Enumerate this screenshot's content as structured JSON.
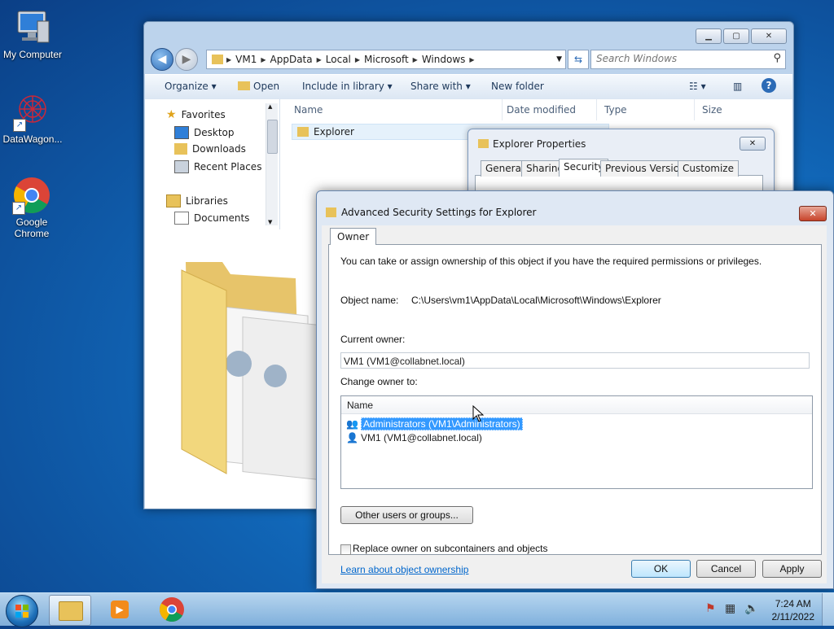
{
  "desktop": {
    "icons": [
      {
        "label": "My Computer"
      },
      {
        "label": "DataWagon..."
      },
      {
        "label": "Google Chrome"
      }
    ]
  },
  "explorer": {
    "breadcrumbs": [
      "VM1",
      "AppData",
      "Local",
      "Microsoft",
      "Windows"
    ],
    "search_placeholder": "Search Windows",
    "toolbar": {
      "organize": "Organize",
      "open": "Open",
      "include": "Include in library",
      "share": "Share with",
      "new_folder": "New folder"
    },
    "nav": {
      "favorites": "Favorites",
      "desktop": "Desktop",
      "downloads": "Downloads",
      "recent": "Recent Places",
      "libraries": "Libraries",
      "documents": "Documents"
    },
    "columns": [
      "Name",
      "Date modified",
      "Type",
      "Size"
    ],
    "file_item": "Explorer"
  },
  "properties": {
    "title": "Explorer Properties",
    "tabs": [
      "General",
      "Sharing",
      "Security",
      "Previous Versions",
      "Customize"
    ],
    "active_tab": "Security"
  },
  "advanced": {
    "title": "Advanced Security Settings for Explorer",
    "tab": "Owner",
    "intro": "You can take or assign ownership of this object if you have the required permissions or privileges.",
    "object_name_label": "Object name:",
    "object_name_value": "C:\\Users\\vm1\\AppData\\Local\\Microsoft\\Windows\\Explorer",
    "current_owner_label": "Current owner:",
    "current_owner_value": "VM1 (VM1@collabnet.local)",
    "change_owner_label": "Change owner to:",
    "list_header": "Name",
    "owners": [
      {
        "name": "Administrators (VM1\\Administrators)",
        "selected": true
      },
      {
        "name": "VM1 (VM1@collabnet.local)",
        "selected": false
      }
    ],
    "other_users_button": "Other users or groups...",
    "replace_checkbox_label": "Replace owner on subcontainers and objects",
    "replace_checked": false,
    "learn_link": "Learn about object ownership",
    "ok": "OK",
    "cancel": "Cancel",
    "apply": "Apply"
  },
  "taskbar": {
    "time": "7:24 AM",
    "date": "2/11/2022"
  }
}
